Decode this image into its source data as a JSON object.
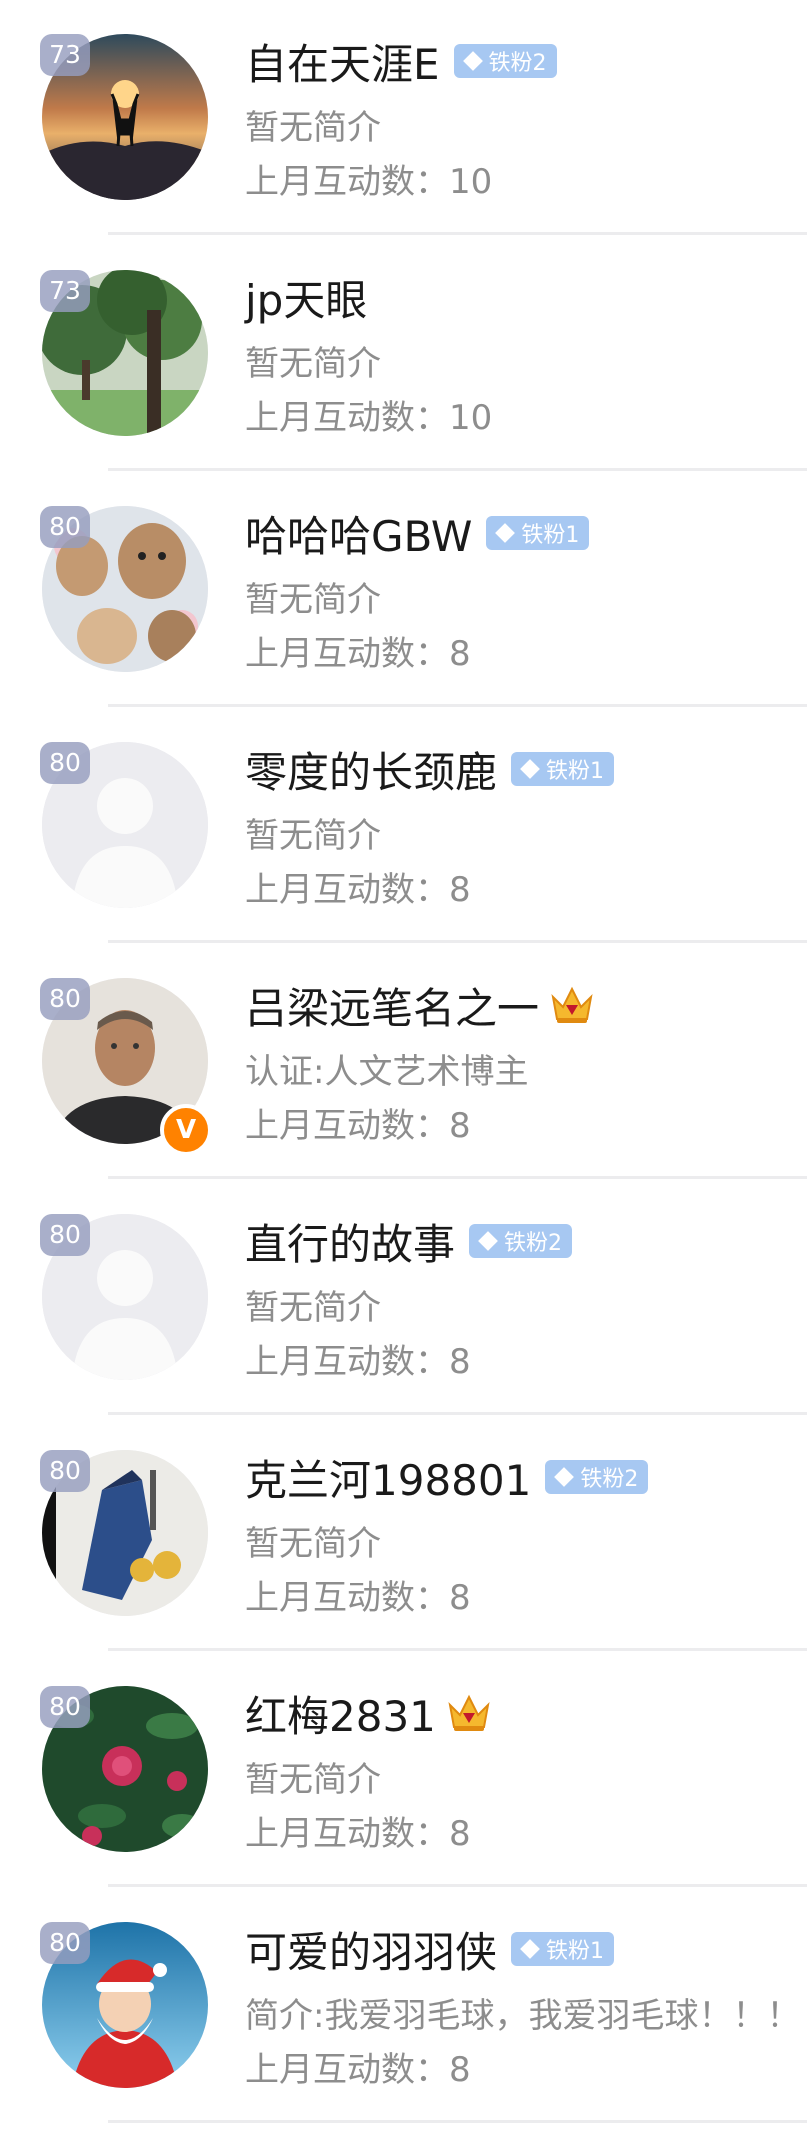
{
  "users": [
    {
      "level": "73",
      "name": "自在天涯E",
      "badge": "铁粉2",
      "badge_type": "fan",
      "bio": "暂无简介",
      "interact": "上月互动数：10",
      "avatar": "deer-sunset"
    },
    {
      "level": "73",
      "name": "jp天眼",
      "badge": "",
      "badge_type": "none",
      "bio": "暂无简介",
      "interact": "上月互动数：10",
      "avatar": "tree-park"
    },
    {
      "level": "80",
      "name": "哈哈哈GBW",
      "badge": "铁粉1",
      "badge_type": "fan",
      "bio": "暂无简介",
      "interact": "上月互动数：8",
      "avatar": "rabbits"
    },
    {
      "level": "80",
      "name": "零度的长颈鹿",
      "badge": "铁粉1",
      "badge_type": "fan",
      "bio": "暂无简介",
      "interact": "上月互动数：8",
      "avatar": "default"
    },
    {
      "level": "80",
      "name": "吕梁远笔名之一",
      "badge": "",
      "badge_type": "crown",
      "bio": "认证:人文艺术博主",
      "interact": "上月互动数：8",
      "avatar": "man-portrait",
      "verified": "V"
    },
    {
      "level": "80",
      "name": "直行的故事",
      "badge": "铁粉2",
      "badge_type": "fan",
      "bio": "暂无简介",
      "interact": "上月互动数：8",
      "avatar": "default"
    },
    {
      "level": "80",
      "name": "克兰河198801",
      "badge": "铁粉2",
      "badge_type": "fan",
      "bio": "暂无简介",
      "interact": "上月互动数：8",
      "avatar": "painting"
    },
    {
      "level": "80",
      "name": "红梅2831",
      "badge": "",
      "badge_type": "crown",
      "bio": "暂无简介",
      "interact": "上月互动数：8",
      "avatar": "roses"
    },
    {
      "level": "80",
      "name": "可爱的羽羽侠",
      "badge": "铁粉1",
      "badge_type": "fan",
      "bio": "简介:我爱羽毛球，我爱羽毛球！！！",
      "interact": "上月互动数：8",
      "avatar": "santa"
    }
  ],
  "colors": {
    "fan_badge": "#a7c8f2",
    "level_badge": "#969ebe",
    "verified": "#ff8200",
    "text_primary": "#1a1a1a",
    "text_secondary": "#8d8d8d"
  }
}
